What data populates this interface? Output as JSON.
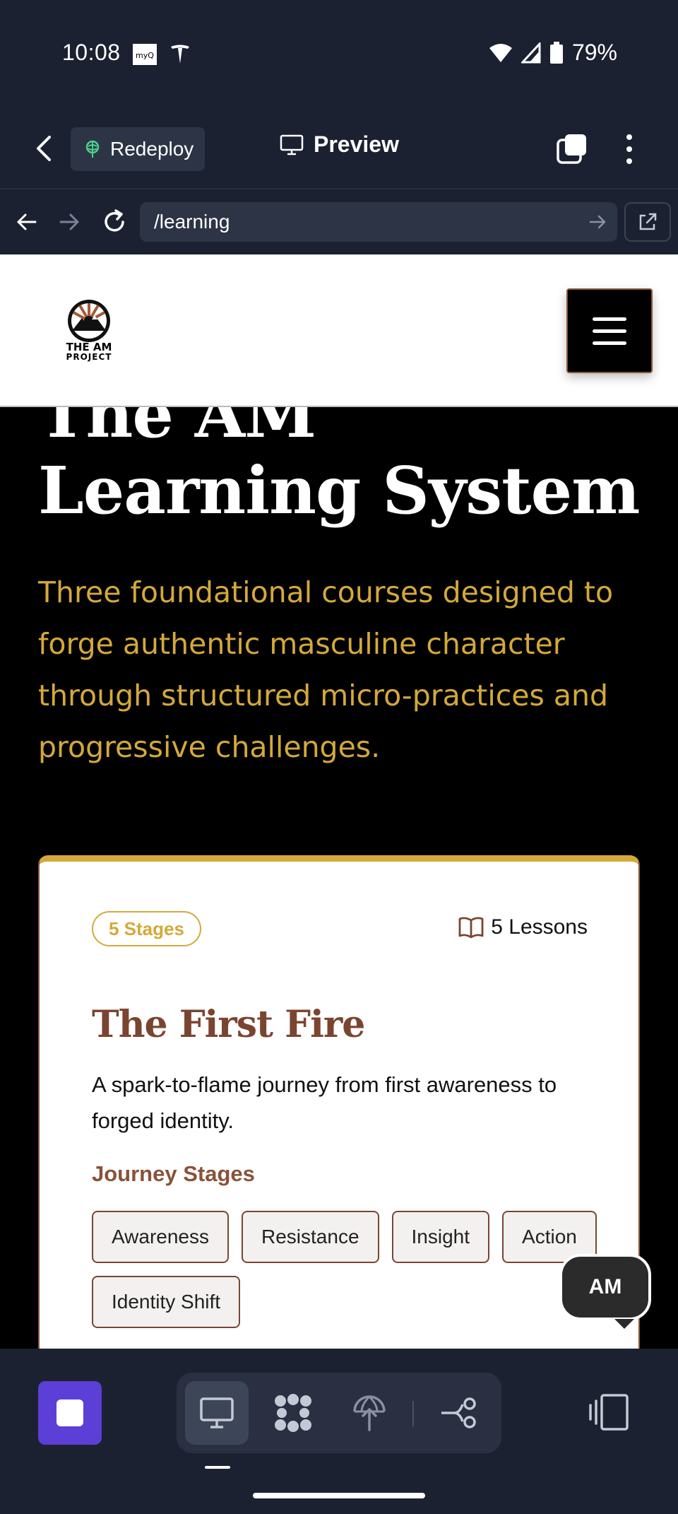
{
  "status_bar": {
    "time": "10:08",
    "app_icons": [
      "myq-icon",
      "tesla-icon"
    ],
    "battery": "79%"
  },
  "toolbar": {
    "redeploy_label": "Redeploy",
    "preview_label": "Preview"
  },
  "urlbar": {
    "url": "/learning"
  },
  "site": {
    "logo_line1": "THE AM",
    "logo_line2": "PROJECT",
    "hero_title": "The AM Learning System",
    "hero_subtitle": "Three foundational courses designed to forge authentic masculine character through structured micro-practices and progressive challenges."
  },
  "course_card": {
    "stages_badge": "5 Stages",
    "lessons": "5 Lessons",
    "title": "The First Fire",
    "description": "A spark-to-flame journey from first awareness to forged identity.",
    "journey_heading": "Journey Stages",
    "stages": [
      "Awareness",
      "Resistance",
      "Insight",
      "Action",
      "Identity Shift"
    ]
  },
  "chat_bubble": {
    "label": "AM"
  },
  "colors": {
    "app_bg": "#1c2131",
    "gold": "#d4a93a",
    "brown": "#7a4530",
    "stop_purple": "#5b3fd6"
  }
}
